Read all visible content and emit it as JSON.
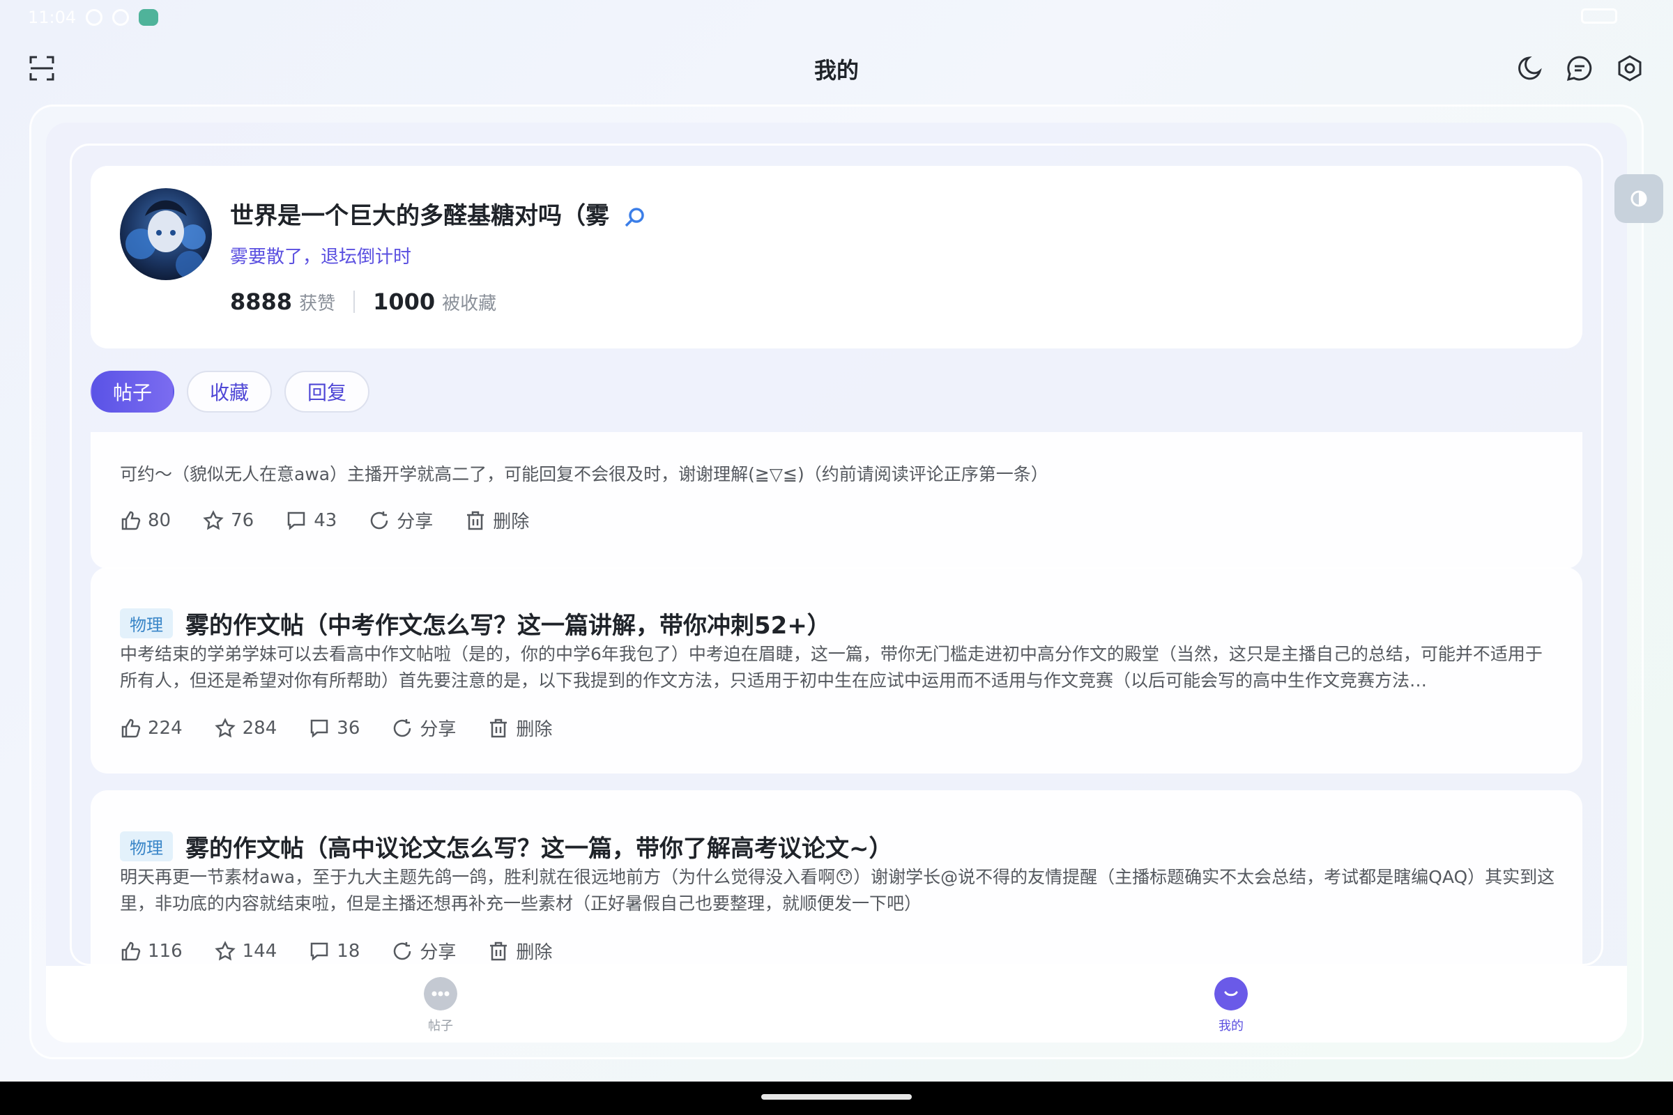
{
  "status_bar": {
    "time": "11:04"
  },
  "header": {
    "title": "我的"
  },
  "profile": {
    "nickname": "世界是一个巨大的多醛基糖对吗（雾",
    "bio": "雾要散了，退坛倒计时",
    "likes_count": "8888",
    "likes_label": "获赞",
    "collected_count": "1000",
    "collected_label": "被收藏"
  },
  "tabs": [
    {
      "label": "帖子",
      "active": true
    },
    {
      "label": "收藏",
      "active": false
    },
    {
      "label": "回复",
      "active": false
    }
  ],
  "posts": [
    {
      "tag": "",
      "title": "",
      "body": "可约～（貌似无人在意awa）主播开学就高二了，可能回复不会很及时，谢谢理解(≧▽≦)（约前请阅读评论正序第一条）",
      "likes": "80",
      "stars": "76",
      "comments": "43",
      "share_label": "分享",
      "delete_label": "删除"
    },
    {
      "tag": "物理",
      "title": "雾的作文帖（中考作文怎么写？这一篇讲解，带你冲刺52+）",
      "body": "中考结束的学弟学妹可以去看高中作文帖啦（是的，你的中学6年我包了）中考迫在眉睫，这一篇，带你无门槛走进初中高分作文的殿堂（当然，这只是主播自己的总结，可能并不适用于所有人，但还是希望对你有所帮助）首先要注意的是，以下我提到的作文方法，只适用于初中生在应试中运用而不适用与作文竞赛（以后可能会写的高中生作文竞赛方法…",
      "likes": "224",
      "stars": "284",
      "comments": "36",
      "share_label": "分享",
      "delete_label": "删除"
    },
    {
      "tag": "物理",
      "title": "雾的作文帖（高中议论文怎么写？这一篇，带你了解高考议论文~）",
      "body": "明天再更一节素材awa，至于九大主题先鸽一鸽，胜利就在很远地前方（为什么觉得没入看啊😯）谢谢学长@说不得的友情提醒（主播标题确实不太会总结，考试都是瞎编QAQ）其实到这里，非功底的内容就结束啦，但是主播还想再补充一些素材（正好暑假自己也要整理，就顺便发一下吧）",
      "likes": "116",
      "stars": "144",
      "comments": "18",
      "share_label": "分享",
      "delete_label": "删除"
    }
  ],
  "bottom_nav": [
    {
      "label": "帖子",
      "icon": "chat-bubble-icon",
      "active": false
    },
    {
      "label": "我的",
      "icon": "smile-icon",
      "active": true
    }
  ],
  "colors": {
    "accent": "#5a4fe0",
    "tag_text": "#3a86c8",
    "tag_bg": "#e3f1fb"
  }
}
